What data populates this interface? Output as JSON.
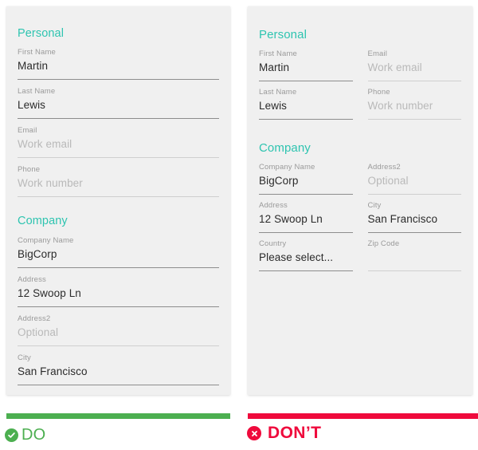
{
  "do_card": {
    "sections": [
      {
        "title": "Personal",
        "fields": [
          {
            "label": "First Name",
            "value": "Martin",
            "empty": false
          },
          {
            "label": "Last Name",
            "value": "Lewis",
            "empty": false
          },
          {
            "label": "Email",
            "value": "Work email",
            "empty": true
          },
          {
            "label": "Phone",
            "value": "Work number",
            "empty": true
          }
        ]
      },
      {
        "title": "Company",
        "fields": [
          {
            "label": "Company Name",
            "value": "BigCorp",
            "empty": false
          },
          {
            "label": "Address",
            "value": "12 Swoop Ln",
            "empty": false
          },
          {
            "label": "Address2",
            "value": "Optional",
            "empty": true
          },
          {
            "label": "City",
            "value": "San Francisco",
            "empty": false
          }
        ]
      }
    ]
  },
  "dont_card": {
    "sections": [
      {
        "title": "Personal",
        "rows": [
          [
            {
              "label": "First Name",
              "value": "Martin",
              "empty": false
            },
            {
              "label": "Email",
              "value": "Work email",
              "empty": true
            }
          ],
          [
            {
              "label": "Last Name",
              "value": "Lewis",
              "empty": false
            },
            {
              "label": "Phone",
              "value": "Work number",
              "empty": true
            }
          ]
        ]
      },
      {
        "title": "Company",
        "rows": [
          [
            {
              "label": "Company Name",
              "value": "BigCorp",
              "empty": false
            },
            {
              "label": "Address2",
              "value": "Optional",
              "empty": true
            }
          ],
          [
            {
              "label": "Address",
              "value": "12 Swoop Ln",
              "empty": false
            },
            {
              "label": "City",
              "value": "San Francisco",
              "empty": false
            }
          ],
          [
            {
              "label": "Country",
              "value": "Please select...",
              "empty": false
            },
            {
              "label": "Zip Code",
              "value": "",
              "empty": true
            }
          ]
        ]
      }
    ]
  },
  "footer": {
    "do": {
      "label": "DO",
      "icon": "check-circle-icon",
      "color": "#4caf50"
    },
    "dont": {
      "label": "DON’T",
      "icon": "x-circle-icon",
      "color": "#ef0a3c"
    }
  },
  "theme": {
    "section_title_color": "#2ec4b0",
    "card_background": "#f0f0f0",
    "page_background": "#ffffff",
    "value_color": "#2b2b2b",
    "label_color": "#9a9a9a",
    "placeholder_color": "#b9b9b9"
  }
}
